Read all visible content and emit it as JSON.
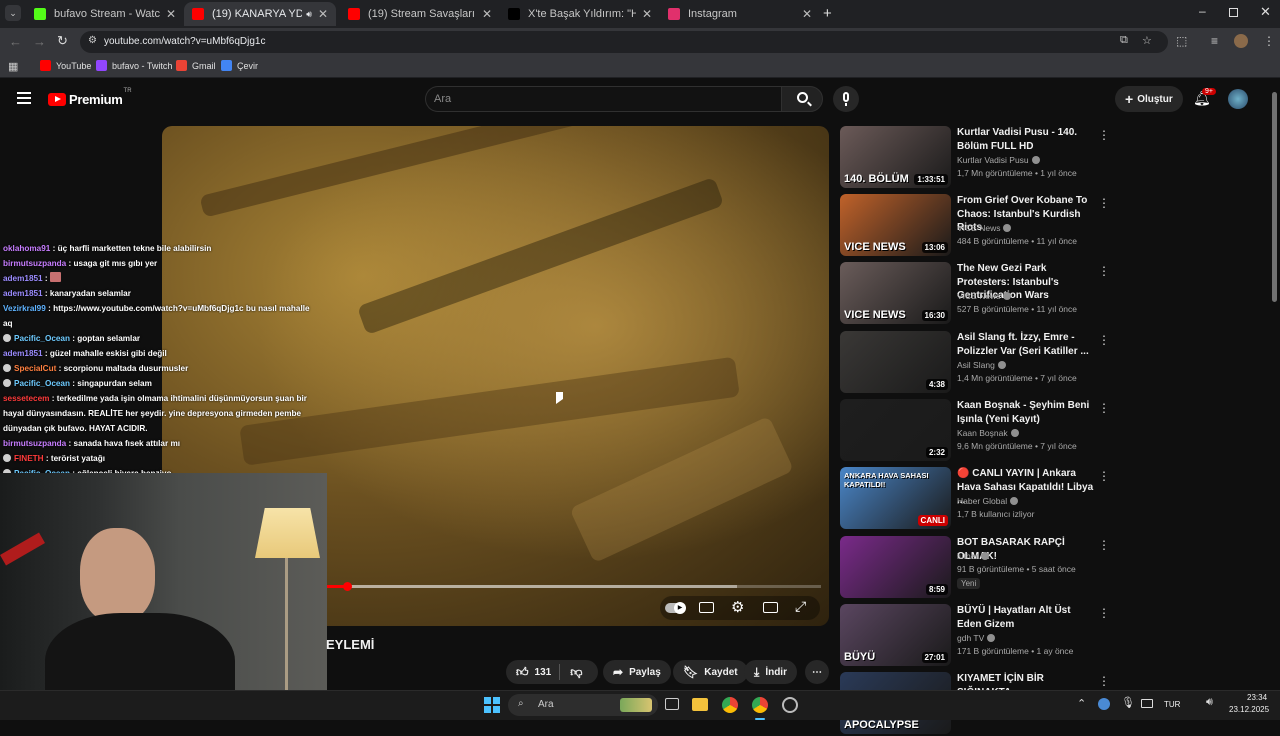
{
  "browser": {
    "tabs": [
      {
        "label": "bufavo Stream - Watch Live on",
        "color": "#53fc18"
      },
      {
        "label": "(19) KANARYA YDG-H KOB",
        "color": "#ff0000",
        "active": true
      },
      {
        "label": "(19) Stream Savaşları Ebo x Uzi",
        "color": "#ff0000"
      },
      {
        "label": "X'te Başak Yıldırım: \"Haymana'd",
        "color": "#000000"
      },
      {
        "label": "Instagram",
        "color": "#e1306c"
      }
    ],
    "url": "youtube.com/watch?v=uMbf6qDjg1c",
    "bookmarks": [
      {
        "label": "YouTube",
        "color": "#ff0000"
      },
      {
        "label": "bufavo - Twitch",
        "color": "#9146ff"
      },
      {
        "label": "Gmail",
        "color": "#ea4335"
      },
      {
        "label": "Çevir",
        "color": "#4285f4"
      }
    ]
  },
  "youtube": {
    "logo": "Premium",
    "region": "TR",
    "search_placeholder": "Ara",
    "create_label": "Oluştur",
    "notifications_count": "9+"
  },
  "chat": [
    {
      "user": "oklahoma91",
      "ucolor": "#c77dff",
      "text": "üç harfli marketten tekne bile alabilirsin"
    },
    {
      "user": "birmutsuzpanda",
      "ucolor": "#c77dff",
      "text": "usaga git mıs gıbı yer"
    },
    {
      "user": "adem1851",
      "ucolor": "#9c8cff",
      "text": "",
      "emote": true
    },
    {
      "user": "adem1851",
      "ucolor": "#9c8cff",
      "text": "kanaryadan selamlar"
    },
    {
      "user": "Vezirkral99",
      "ucolor": "#5fb3ff",
      "text": "https://www.youtube.com/watch?v=uMbf6qDjg1c bu nasıl mahalle"
    },
    {
      "user": "",
      "ucolor": "#ffffff",
      "text": "aq"
    },
    {
      "user": "Pacific_Ocean",
      "ucolor": "#6ecbff",
      "text": "goptan selamlar",
      "dot": true
    },
    {
      "user": "adem1851",
      "ucolor": "#9c8cff",
      "text": "güzel mahalle eskisi gibi değil"
    },
    {
      "user": "SpecialCut",
      "ucolor": "#ff7f3f",
      "text": "scorpionu maltada dusurmusler",
      "dot": true
    },
    {
      "user": "Pacific_Ocean",
      "ucolor": "#6ecbff",
      "text": "singapurdan selam",
      "dot": true
    },
    {
      "user": "sessetecem",
      "ucolor": "#ff3b3b",
      "text": "terkedilme yada işin olmama ihtimalini düşünmüyorsun şuan bir"
    },
    {
      "user": "",
      "ucolor": "#ffffff",
      "text": "hayal dünyasındasın. REALİTE her şeydir. yine depresyona girmeden pembe"
    },
    {
      "user": "",
      "ucolor": "#ffffff",
      "text": "dünyadan çık bufavo. HAYAT ACIDIR."
    },
    {
      "user": "birmutsuzpanda",
      "ucolor": "#c77dff",
      "text": "sanada hava fısek attılar mı"
    },
    {
      "user": "FINETH",
      "ucolor": "#ff3b3b",
      "text": "terörist yatağı",
      "dot": true
    },
    {
      "user": "Pacific_Ocean",
      "ucolor": "#6ecbff",
      "text": "eğlenceli biyere benziyo",
      "dot": true
    }
  ],
  "video": {
    "title_fragment": "EYLEMİ",
    "progress": 0.04,
    "buffered": 0.83
  },
  "actions": {
    "likes": "131",
    "share": "Paylaş",
    "save": "Kaydet",
    "download": "İndir"
  },
  "sidebar": [
    {
      "title": "Kurtlar Vadisi Pusu - 140. Bölüm FULL HD",
      "channel": "Kurtlar Vadisi Pusu",
      "verified": true,
      "meta": "1,7 Mn görüntüleme • 1 yıl önce",
      "duration": "1:33:51",
      "overlay": "140. BÖLÜM",
      "thumb": "#6b5a58"
    },
    {
      "title": "From Grief Over Kobane To Chaos: Istanbul's Kurdish Riots",
      "channel": "VICE News",
      "verified": true,
      "meta": "484 B görüntüleme • 11 yıl önce",
      "duration": "13:06",
      "overlay": "VICE NEWS",
      "thumb": "#c0622a"
    },
    {
      "title": "The New Gezi Park Protesters: Istanbul's Gentrification Wars",
      "channel": "VICE News",
      "verified": true,
      "meta": "527 B görüntüleme • 11 yıl önce",
      "duration": "16:30",
      "overlay": "VICE NEWS",
      "thumb": "#6a5c5a"
    },
    {
      "title": "Asil Slang ft. İzzy, Emre - Polizzler Var (Seri Katiller ...",
      "channel": "Asil Slang",
      "verified": true,
      "meta": "1,4 Mn görüntüleme • 7 yıl önce",
      "duration": "4:38",
      "overlay": "",
      "thumb": "#3a3836"
    },
    {
      "title": "Kaan Boşnak - Şeyhim Beni Işınla (Yeni Kayıt)",
      "channel": "Kaan Boşnak",
      "verified": true,
      "meta": "9,6 Mn görüntüleme • 7 yıl önce",
      "duration": "2:32",
      "overlay": "",
      "thumb": "#1e1e1e"
    },
    {
      "title": "🔴 CANLI YAYIN | Ankara Hava Sahası Kapatıldı! Libya ...",
      "channel": "Haber Global",
      "verified": true,
      "meta": "1,7 B kullanıcı izliyor",
      "duration": "CANLI",
      "overlay": "ANKARA HAVA SAHASI KAPATILDI!",
      "thumb": "#4a86c8"
    },
    {
      "title": "BOT BASARAK RAPÇİ OLMAK!",
      "channel": "luther",
      "verified": true,
      "meta": "91 B görüntüleme • 5 saat önce",
      "duration": "8:59",
      "overlay": "",
      "thumb": "#7a2a8a",
      "badge": "Yeni"
    },
    {
      "title": "BÜYÜ | Hayatları Alt Üst Eden Gizem",
      "channel": "gdh TV",
      "verified": true,
      "meta": "171 B görüntüleme • 1 ay önce",
      "duration": "27:01",
      "overlay": "BÜYÜ",
      "thumb": "#5a4660"
    },
    {
      "title": "KIYAMET İÇİN BİR SIĞINAKTA",
      "channel": "",
      "verified": false,
      "meta": "",
      "duration": "",
      "overlay": "APOCALYPSE",
      "thumb": "#2a3a58"
    }
  ],
  "taskbar": {
    "search_label": "Ara",
    "lang": "TUR",
    "time": "23:34",
    "date": "23.12.2025"
  }
}
